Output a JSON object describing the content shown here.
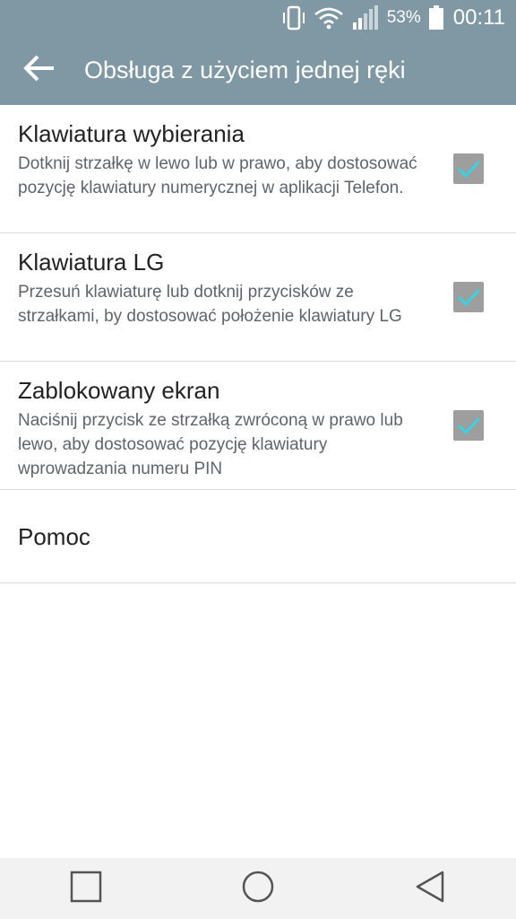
{
  "status_bar": {
    "battery_percent": "53%",
    "time": "00:11",
    "icons": [
      "vibrate-icon",
      "wifi-icon",
      "signal-icon",
      "battery-icon"
    ]
  },
  "app_bar": {
    "back_icon": "back-arrow-icon",
    "title": "Obsługa z użyciem jednej ręki"
  },
  "settings": [
    {
      "title": "Klawiatura wybierania",
      "description": "Dotknij strzałkę w lewo lub w prawo, aby dostosować pozycję klawiatury numerycznej w aplikacji Telefon.",
      "checked": true
    },
    {
      "title": "Klawiatura LG",
      "description": "Przesuń klawiaturę lub dotknij przycisków ze strzałkami, by dostosować położenie klawiatury LG",
      "checked": true
    },
    {
      "title": "Zablokowany ekran",
      "description": "Naciśnij przycisk ze strzałką zwróconą w prawo lub lewo, aby dostosować pozycję klawiatury wprowadzania numeru PIN",
      "checked": true
    }
  ],
  "help": {
    "title": "Pomoc"
  },
  "nav_bar": {
    "buttons": [
      "recent-apps-icon",
      "home-icon",
      "back-icon"
    ]
  },
  "colors": {
    "header": "#7f98a3",
    "checkbox_bg": "#9e9e9e",
    "check_mark": "#3fd0e0",
    "nav_bg": "#f2f2f2"
  }
}
